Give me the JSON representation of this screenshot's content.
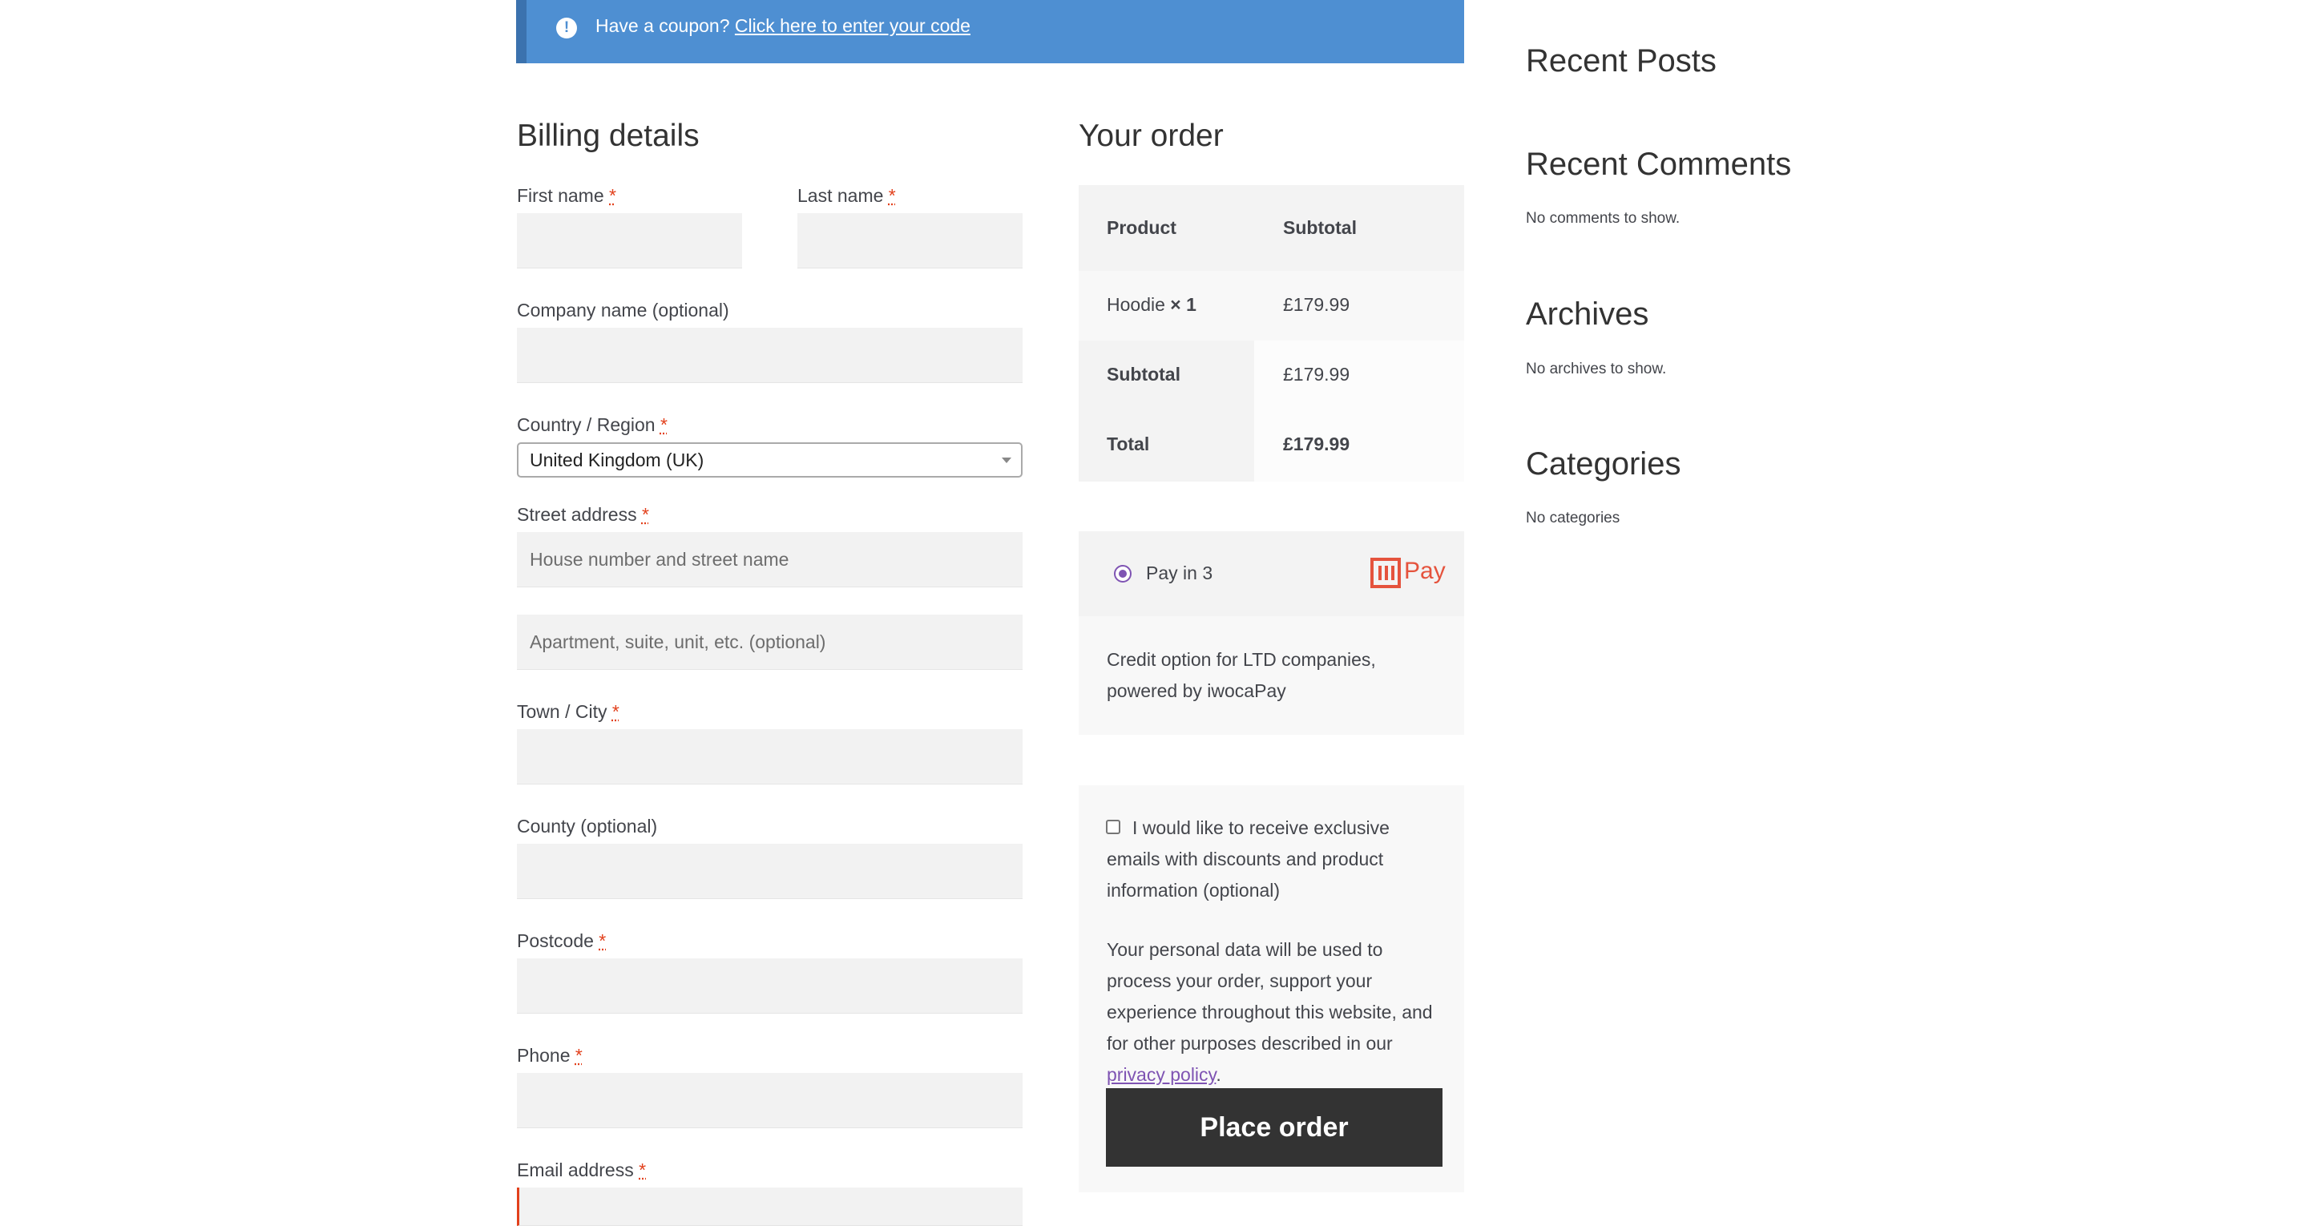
{
  "notice": {
    "text": "Have a coupon?",
    "link": "Click here to enter your code"
  },
  "billing": {
    "title": "Billing details",
    "first_name": {
      "label": "First name",
      "required": "*"
    },
    "last_name": {
      "label": "Last name",
      "required": "*"
    },
    "company": {
      "label": "Company name (optional)"
    },
    "country": {
      "label": "Country / Region",
      "required": "*",
      "value": "United Kingdom (UK)"
    },
    "street": {
      "label": "Street address",
      "required": "*",
      "placeholder1": "House number and street name",
      "placeholder2": "Apartment, suite, unit, etc. (optional)"
    },
    "town": {
      "label": "Town / City",
      "required": "*"
    },
    "county": {
      "label": "County (optional)"
    },
    "postcode": {
      "label": "Postcode",
      "required": "*"
    },
    "phone": {
      "label": "Phone",
      "required": "*"
    },
    "email": {
      "label": "Email address",
      "required": "*"
    }
  },
  "order": {
    "title": "Your order",
    "col_product": "Product",
    "col_subtotal": "Subtotal",
    "item_name": "Hoodie",
    "item_qty": "× 1",
    "item_price": "£179.99",
    "subtotal_label": "Subtotal",
    "subtotal_value": "£179.99",
    "total_label": "Total",
    "total_value": "£179.99"
  },
  "payment": {
    "method": "Pay in 3",
    "logo_text": "Pay",
    "description": "Credit option for LTD companies, powered by iwocaPay"
  },
  "consent": {
    "checkbox_label": "I would like to receive exclusive emails with discounts and product information (optional)",
    "privacy_text": "Your personal data will be used to process your order, support your experience throughout this website, and for other purposes described in our",
    "privacy_link": "privacy policy",
    "privacy_end": ".",
    "place_order": "Place order"
  },
  "sidebar": {
    "recent_posts": "Recent Posts",
    "recent_comments": "Recent Comments",
    "no_comments": "No comments to show.",
    "archives": "Archives",
    "no_archives": "No archives to show.",
    "categories": "Categories",
    "no_categories": "No categories"
  },
  "colors": {
    "notice_bg": "#4e8fd2",
    "accent_purple": "#7f54b3",
    "required_red": "#e2401c",
    "button_bg": "#333333",
    "iwoca_red": "#e5533d"
  }
}
